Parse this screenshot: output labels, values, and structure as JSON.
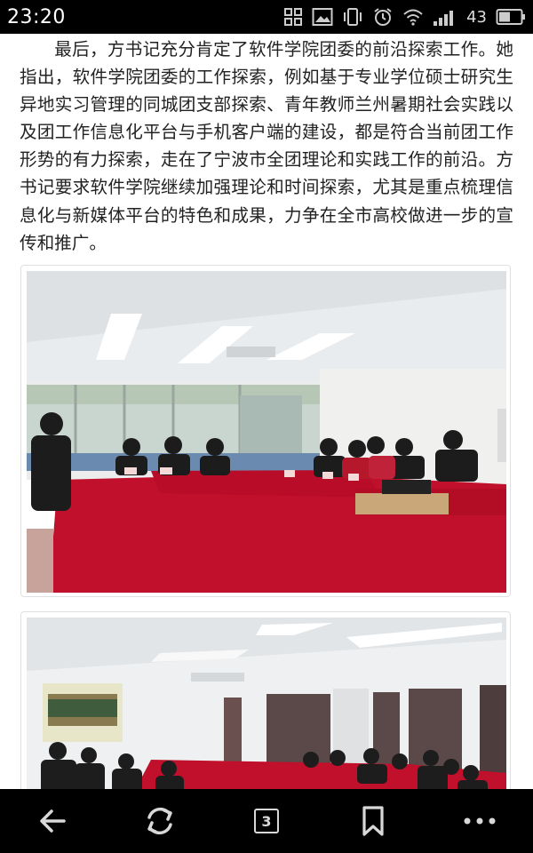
{
  "status_bar": {
    "time": "23:20",
    "battery_level": "43",
    "icons": [
      "screenshot-icon",
      "image-icon",
      "vibrate-icon",
      "alarm-icon",
      "wifi-icon",
      "signal-icon",
      "battery-icon"
    ]
  },
  "article": {
    "paragraph": "最后，方书记充分肯定了软件学院团委的前沿探索工作。她指出，软件学院团委的工作探索，例如基于专业学位硕士研究生异地实习管理的同城团支部探索、青年教师兰州暑期社会实践以及团工作信息化平台与手机客户端的建设，都是符合当前团工作形势的有力探索，走在了宁波市全团理论和实践工作的前沿。方书记要求软件学院继续加强理论和时间探索，尤其是重点梳理信息化与新媒体平台的特色和成果，力争在全市高校做进一步的宣传和推广。"
  },
  "photos": [
    {
      "name": "meeting-photo-1",
      "subject": "conference-room-meeting-red-tables"
    },
    {
      "name": "meeting-photo-2",
      "subject": "conference-room-with-projection-screen"
    }
  ],
  "bottom_nav": {
    "back": "back-arrow-icon",
    "refresh": "refresh-icon",
    "tab_count": "3",
    "bookmark": "bookmark-icon",
    "menu": "more-menu-icon"
  },
  "colors": {
    "status_bg": "#000000",
    "nav_bg": "#000000",
    "table_red": "#c8102e",
    "text": "#222222"
  }
}
